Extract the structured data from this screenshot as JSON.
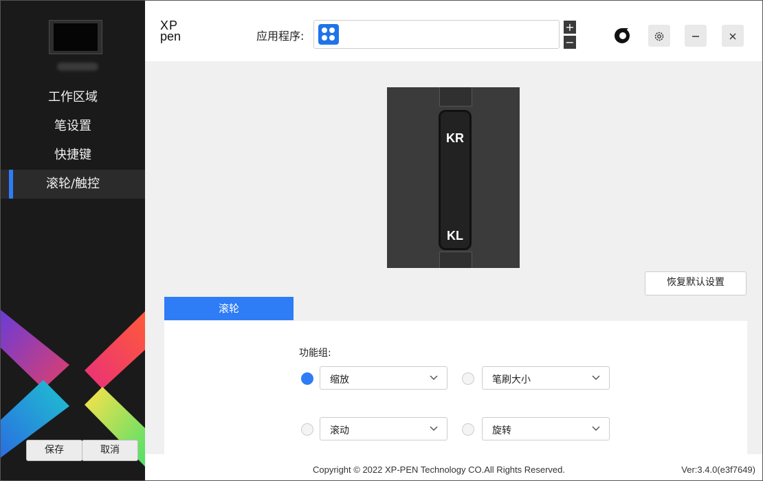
{
  "app": {
    "accent_color": "#2e7cf6",
    "sidebar_bg": "#1a1a1a"
  },
  "sidebar": {
    "device_icon": "tablet-icon",
    "items": [
      {
        "label": "工作区域",
        "active": false
      },
      {
        "label": "笔设置",
        "active": false
      },
      {
        "label": "快捷键",
        "active": false
      },
      {
        "label": "滚轮/触控",
        "active": true
      }
    ],
    "save_label": "保存",
    "cancel_label": "取消"
  },
  "header": {
    "logo_line1": "XP",
    "logo_line2": "pen",
    "app_label": "应用程序:",
    "app_icon": "all-apps-icon",
    "plus_label": "+",
    "minus_label": "−",
    "brand_icon": "xppen-brand-icon",
    "settings_icon": "gear-icon",
    "minimize_icon": "minimize-icon",
    "close_icon": "close-icon"
  },
  "device": {
    "wheel_top_label": "KR",
    "wheel_bottom_label": "KL"
  },
  "reset_label": "恢复默认设置",
  "tabs": [
    {
      "label": "滚轮",
      "active": true
    }
  ],
  "function_group": {
    "label": "功能组:",
    "options": [
      {
        "value": "缩放",
        "checked": true
      },
      {
        "value": "笔刷大小",
        "checked": false
      },
      {
        "value": "滚动",
        "checked": false
      },
      {
        "value": "旋转",
        "checked": false
      }
    ]
  },
  "footer": {
    "copyright": "Copyright © 2022  XP-PEN Technology CO.All Rights Reserved.",
    "version": "Ver:3.4.0(e3f7649)"
  }
}
